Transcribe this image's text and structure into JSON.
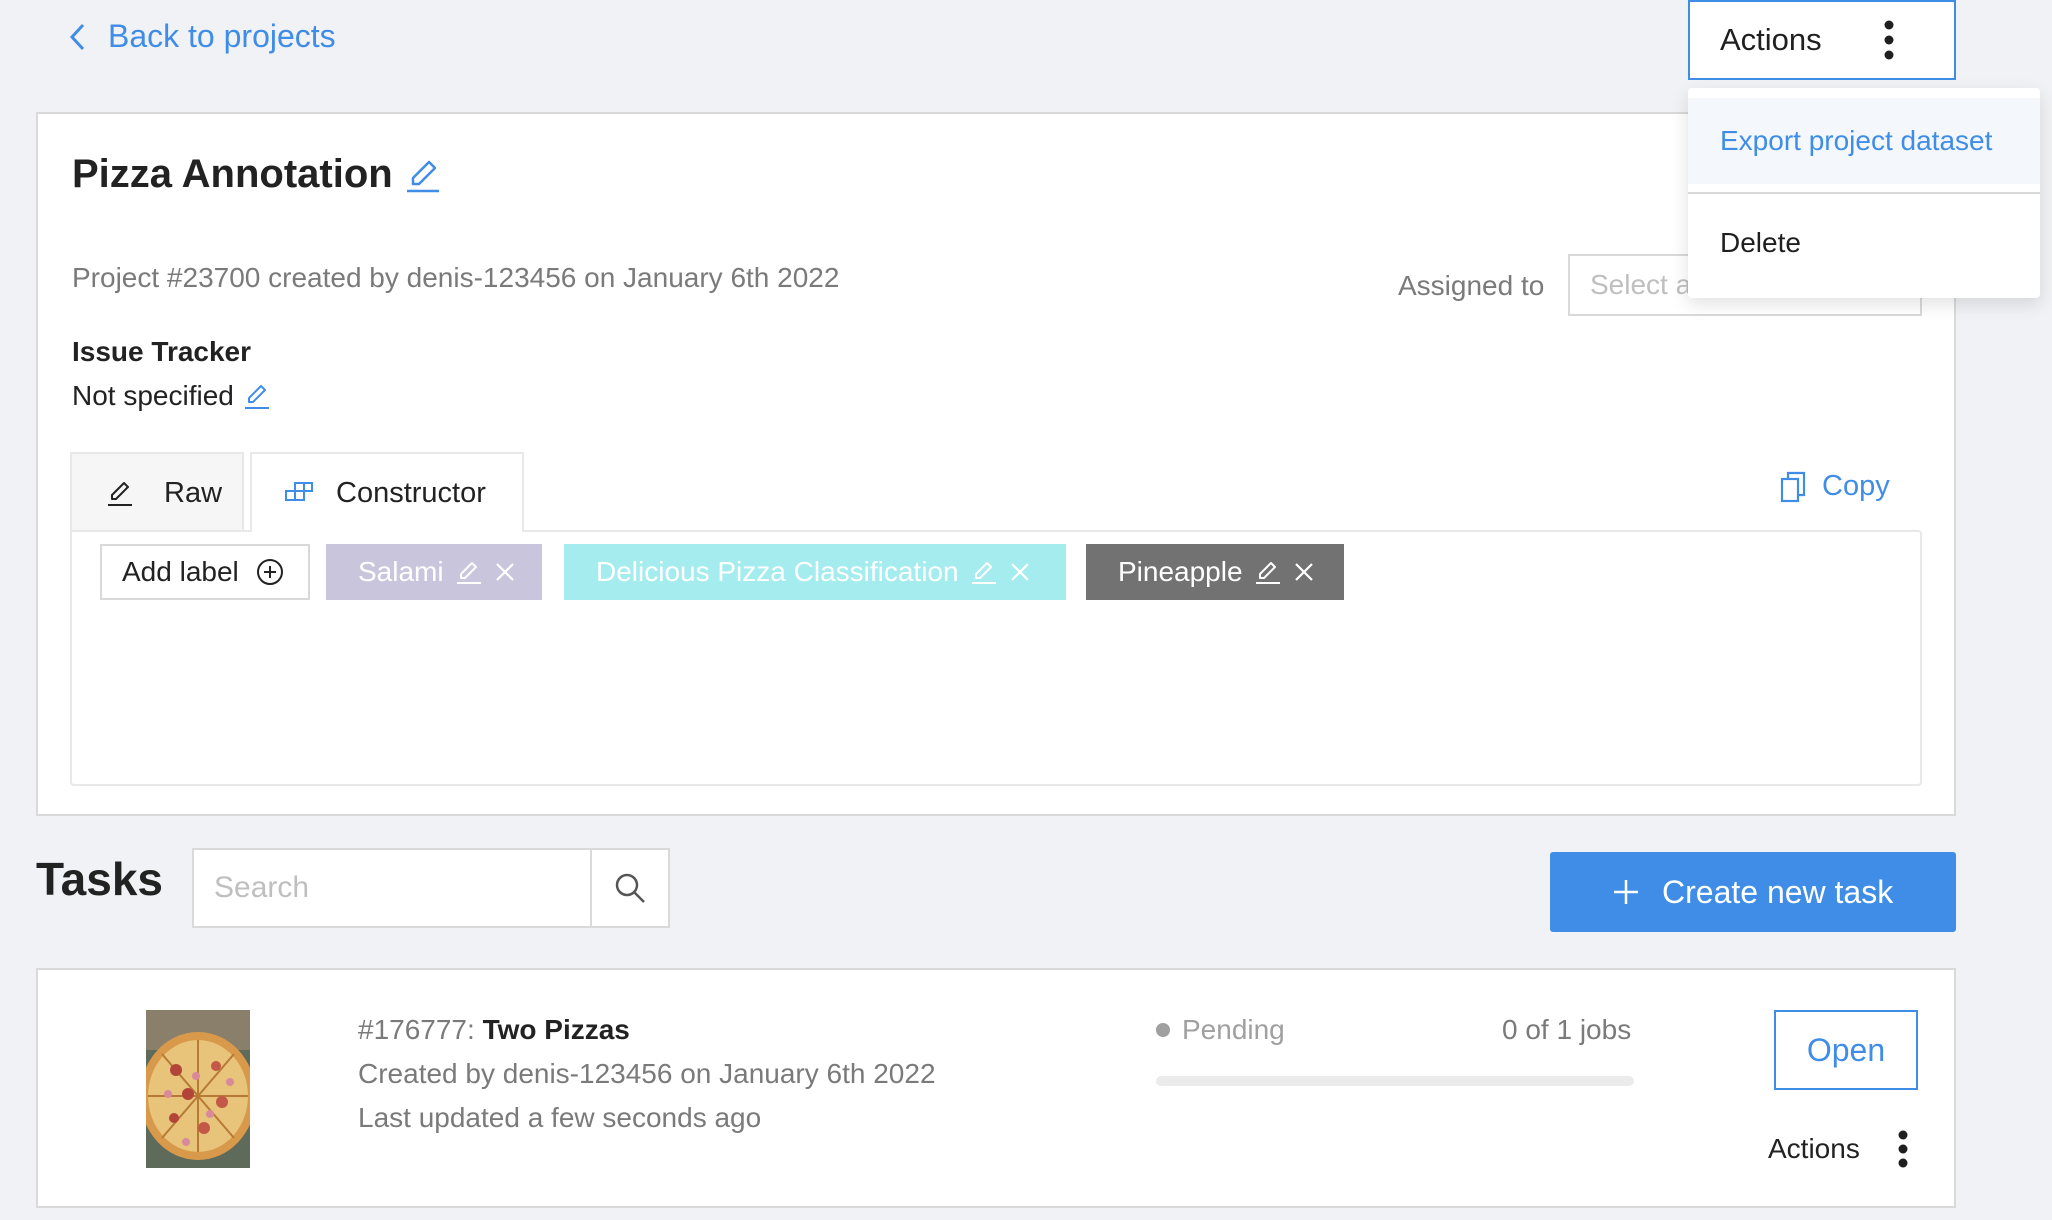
{
  "header": {
    "back_label": "Back to projects",
    "actions_label": "Actions"
  },
  "actions_menu": {
    "items": [
      {
        "label": "Export project dataset",
        "highlighted": true
      },
      {
        "label": "Delete"
      }
    ]
  },
  "project": {
    "title": "Pizza Annotation",
    "meta": "Project #23700 created by denis-123456 on January 6th 2022",
    "assigned_label": "Assigned to",
    "assigned_placeholder": "Select a user",
    "issue_tracker": {
      "heading": "Issue Tracker",
      "value": "Not specified"
    },
    "tabs": [
      {
        "label": "Raw",
        "icon": "pencil-icon",
        "active": false
      },
      {
        "label": "Constructor",
        "icon": "blocks-icon",
        "active": true
      }
    ],
    "copy_label": "Copy",
    "add_label": "Add label",
    "labels": [
      {
        "name": "Salami",
        "color": "#c8c5dc"
      },
      {
        "name": "Delicious Pizza Classification",
        "color": "#a5ecee"
      },
      {
        "name": "Pineapple",
        "color": "#727272"
      }
    ]
  },
  "tasks": {
    "heading": "Tasks",
    "search_placeholder": "Search",
    "create_label": "Create new task",
    "items": [
      {
        "id": "#176777:",
        "name": "Two Pizzas",
        "created": "Created by denis-123456 on January 6th 2022",
        "updated": "Last updated a few seconds ago",
        "status": "Pending",
        "jobs": "0 of 1 jobs",
        "progress": 0,
        "open_label": "Open",
        "actions_label": "Actions"
      }
    ]
  },
  "colors": {
    "accent": "#3f8de6",
    "background": "#f1f2f5",
    "status_pending": "#a0a0a0"
  }
}
